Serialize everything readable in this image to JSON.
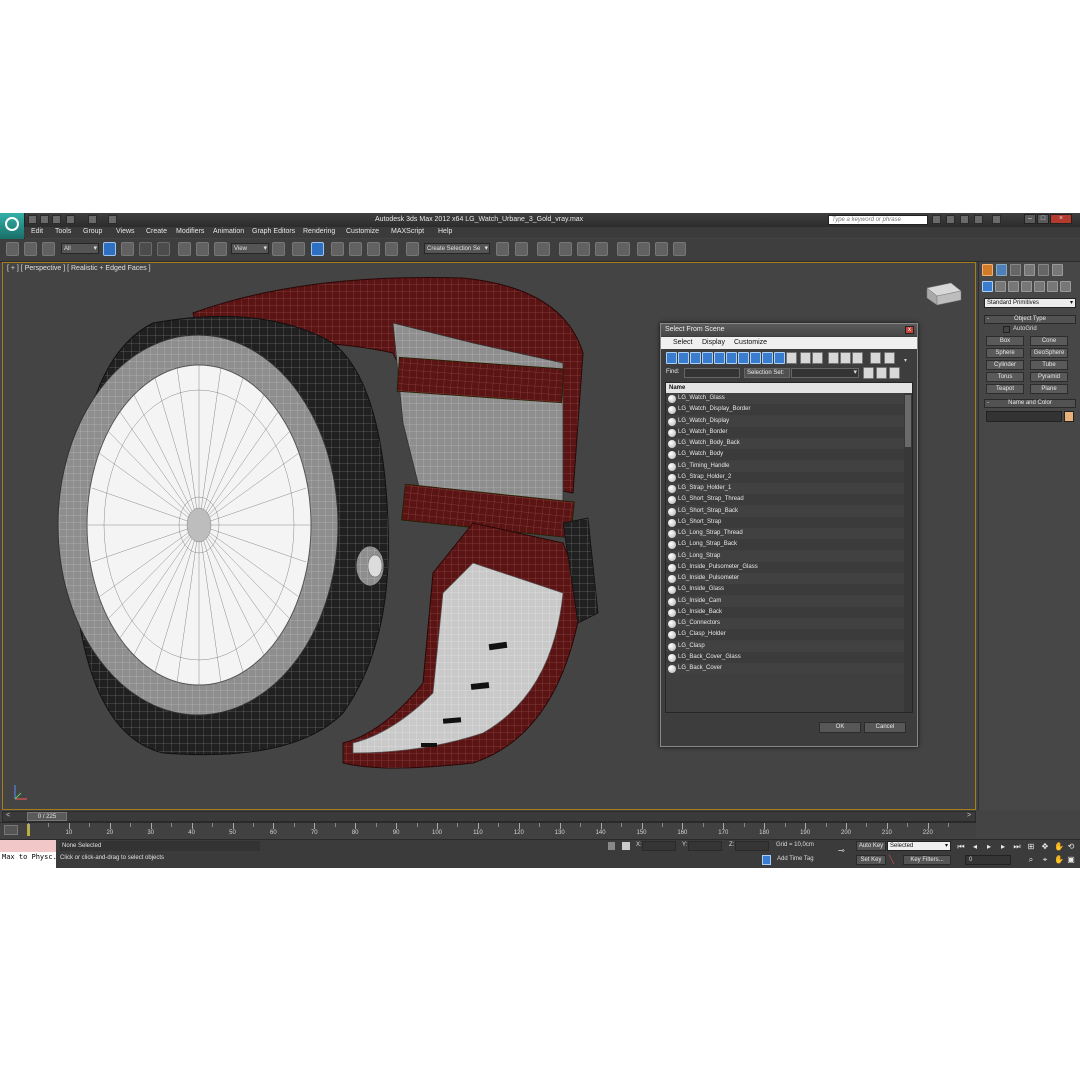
{
  "app": {
    "title": "Autodesk 3ds Max  2012 x64     LG_Watch_Urbane_3_Gold_vray.max",
    "search_placeholder": "Type a keyword or phrase"
  },
  "menu": [
    "Edit",
    "Tools",
    "Group",
    "Views",
    "Create",
    "Modifiers",
    "Animation",
    "Graph Editors",
    "Rendering",
    "Customize",
    "MAXScript",
    "Help"
  ],
  "toolbar": {
    "filter": "All",
    "ref_coord": "View",
    "named_selection": "Create Selection Se"
  },
  "viewport": {
    "label": "[ + ] [ Perspective ] [ Realistic + Edged Faces ]"
  },
  "command_panel": {
    "category": "Standard Primitives",
    "object_type_title": "Object Type",
    "autogrid": "AutoGrid",
    "primitives": [
      "Box",
      "Cone",
      "Sphere",
      "GeoSphere",
      "Cylinder",
      "Tube",
      "Torus",
      "Pyramid",
      "Teapot",
      "Plane"
    ],
    "name_color_title": "Name and Color",
    "rollout_toggle": "-",
    "name_color": "#e8b27a"
  },
  "dialog": {
    "title": "Select From Scene",
    "close": "x",
    "menu": [
      "Select",
      "Display",
      "Customize"
    ],
    "find_label": "Find:",
    "selection_set_label": "Selection Set:",
    "column_name": "Name",
    "objects": [
      "LG_Watch_Glass",
      "LG_Watch_Display_Border",
      "LG_Watch_Display",
      "LG_Watch_Border",
      "LG_Watch_Body_Back",
      "LG_Watch_Body",
      "LG_Timing_Handle",
      "LG_Strap_Holder_2",
      "LG_Strap_Holder_1",
      "LG_Short_Strap_Thread",
      "LG_Short_Strap_Back",
      "LG_Short_Strap",
      "LG_Long_Strap_Thread",
      "LG_Long_Strap_Back",
      "LG_Long_Strap",
      "LG_Inside_Pulsometer_Glass",
      "LG_Inside_Pulsometer",
      "LG_Inside_Glass",
      "LG_Inside_Cam",
      "LG_Inside_Back",
      "LG_Connectors",
      "LG_Clasp_Holder",
      "LG_Clasp",
      "LG_Back_Cover_Glass",
      "LG_Back_Cover"
    ],
    "ok": "OK",
    "cancel": "Cancel"
  },
  "timeline": {
    "current": "0 / 225",
    "ticks": [
      "0",
      "10",
      "20",
      "30",
      "40",
      "50",
      "60",
      "70",
      "80",
      "90",
      "100",
      "110",
      "120",
      "130",
      "140",
      "150",
      "160",
      "170",
      "180",
      "190",
      "200",
      "210",
      "220"
    ]
  },
  "status": {
    "maxscript": "Max to Physc.",
    "selection": "None Selected",
    "prompt": "Click or click-and-drag to select objects",
    "x_label": "X:",
    "y_label": "Y:",
    "z_label": "Z:",
    "grid": "Grid = 10,0cm",
    "add_time_tag": "Add Time Tag",
    "auto_key": "Auto Key",
    "set_key": "Set Key",
    "key_mode": "Selected",
    "key_filters": "Key Filters...",
    "frame": "0"
  },
  "colors": {
    "viewport_border": "#a37d1b",
    "active_tool": "#2f6fc2",
    "strap": "#6b1a1a"
  }
}
